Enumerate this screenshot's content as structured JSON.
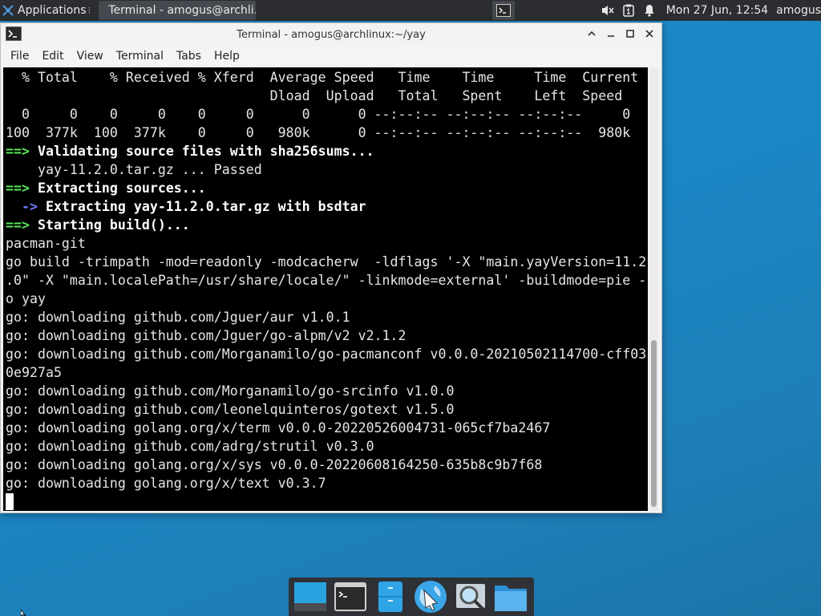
{
  "top_panel": {
    "apps_label": "Applications",
    "task_title": "Terminal - amogus@archli...",
    "clock": "Mon 27 Jun, 12:54",
    "user": "amogus"
  },
  "window": {
    "title": "Terminal - amogus@archlinux:~/yay",
    "menu": [
      "File",
      "Edit",
      "View",
      "Terminal",
      "Tabs",
      "Help"
    ]
  },
  "terminal": {
    "lines": [
      {
        "parts": [
          {
            "t": "  % Total    % Received % Xferd  Average Speed   Time    Time     Time  Current",
            "c": ""
          }
        ]
      },
      {
        "parts": [
          {
            "t": "                                 Dload  Upload   Total   Spent    Left  Speed",
            "c": ""
          }
        ]
      },
      {
        "parts": [
          {
            "t": "  0     0    0     0    0     0      0      0 --:--:-- --:--:-- --:--:--     0",
            "c": ""
          }
        ]
      },
      {
        "parts": [
          {
            "t": "100  377k  100  377k    0     0   980k      0 --:--:-- --:--:-- --:--:--  980k",
            "c": ""
          }
        ]
      },
      {
        "parts": [
          {
            "t": "==> ",
            "c": "green"
          },
          {
            "t": "Validating source files with sha256sums...",
            "c": "bold"
          }
        ]
      },
      {
        "parts": [
          {
            "t": "    yay-11.2.0.tar.gz ... Passed",
            "c": ""
          }
        ]
      },
      {
        "parts": [
          {
            "t": "==> ",
            "c": "green"
          },
          {
            "t": "Extracting sources...",
            "c": "bold"
          }
        ]
      },
      {
        "parts": [
          {
            "t": "  -> ",
            "c": "blue"
          },
          {
            "t": "Extracting yay-11.2.0.tar.gz with bsdtar",
            "c": "bold"
          }
        ]
      },
      {
        "parts": [
          {
            "t": "==> ",
            "c": "green"
          },
          {
            "t": "Starting build()...",
            "c": "bold"
          }
        ]
      },
      {
        "parts": [
          {
            "t": "pacman-git",
            "c": ""
          }
        ]
      },
      {
        "parts": [
          {
            "t": "go build -trimpath -mod=readonly -modcacherw  -ldflags '-X \"main.yayVersion=11.2",
            "c": ""
          }
        ]
      },
      {
        "parts": [
          {
            "t": ".0\" -X \"main.localePath=/usr/share/locale/\" -linkmode=external' -buildmode=pie -",
            "c": ""
          }
        ]
      },
      {
        "parts": [
          {
            "t": "o yay",
            "c": ""
          }
        ]
      },
      {
        "parts": [
          {
            "t": "go: downloading github.com/Jguer/aur v1.0.1",
            "c": ""
          }
        ]
      },
      {
        "parts": [
          {
            "t": "go: downloading github.com/Jguer/go-alpm/v2 v2.1.2",
            "c": ""
          }
        ]
      },
      {
        "parts": [
          {
            "t": "go: downloading github.com/Morganamilo/go-pacmanconf v0.0.0-20210502114700-cff03",
            "c": ""
          }
        ]
      },
      {
        "parts": [
          {
            "t": "0e927a5",
            "c": ""
          }
        ]
      },
      {
        "parts": [
          {
            "t": "go: downloading github.com/Morganamilo/go-srcinfo v1.0.0",
            "c": ""
          }
        ]
      },
      {
        "parts": [
          {
            "t": "go: downloading github.com/leonelquinteros/gotext v1.5.0",
            "c": ""
          }
        ]
      },
      {
        "parts": [
          {
            "t": "go: downloading golang.org/x/term v0.0.0-20220526004731-065cf7ba2467",
            "c": ""
          }
        ]
      },
      {
        "parts": [
          {
            "t": "go: downloading github.com/adrg/strutil v0.3.0",
            "c": ""
          }
        ]
      },
      {
        "parts": [
          {
            "t": "go: downloading golang.org/x/sys v0.0.0-20220608164250-635b8c9b7f68",
            "c": ""
          }
        ]
      },
      {
        "parts": [
          {
            "t": "go: downloading golang.org/x/text v0.3.7",
            "c": ""
          }
        ]
      }
    ]
  },
  "dock": {
    "items": [
      "show-desktop",
      "terminal",
      "file-manager-drawer",
      "web-browser",
      "search",
      "home-folder"
    ]
  },
  "colors": {
    "desktop": "#1f8bc9",
    "terminal_bg": "#000000",
    "prompt_green": "#5ce65c",
    "arrow_blue": "#6f7cff"
  }
}
